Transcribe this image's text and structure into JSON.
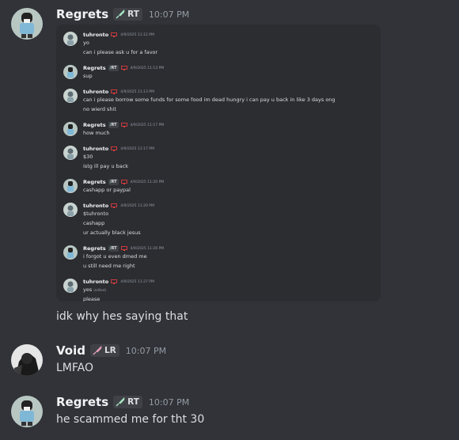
{
  "messages": [
    {
      "username": "Regrets",
      "tag": "RT",
      "time": "10:07 PM",
      "embedded_screenshot": {
        "messages": [
          {
            "username": "tuhronto",
            "time": "4/9/2025 11:12 PM",
            "lines": [
              "yo",
              "can i please ask u for a favor"
            ]
          },
          {
            "username": "Regrets",
            "tag": "RT",
            "time": "4/9/2025 11:13 PM",
            "lines": [
              "sup"
            ]
          },
          {
            "username": "tuhronto",
            "time": "4/9/2025 11:13 PM",
            "lines": [
              "can i please borrow some funds for some food im dead hungry i can pay u back in like 3 days ong",
              "no wierd shit"
            ]
          },
          {
            "username": "Regrets",
            "tag": "RT",
            "time": "4/9/2025 11:17 PM",
            "lines": [
              "how much"
            ]
          },
          {
            "username": "tuhronto",
            "time": "4/9/2025 11:17 PM",
            "lines": [
              "$30",
              "istg ill pay u back"
            ]
          },
          {
            "username": "Regrets",
            "tag": "RT",
            "time": "4/9/2025 11:20 PM",
            "lines": [
              "cashapp or paypal"
            ]
          },
          {
            "username": "tuhronto",
            "time": "4/9/2025 11:20 PM",
            "lines": [
              "$tuhronto",
              "cashapp",
              "ur actually black jesus"
            ]
          },
          {
            "username": "Regrets",
            "tag": "RT",
            "time": "4/9/2025 11:26 PM",
            "lines": [
              "i forgot u even dmed me",
              "u still need me right"
            ]
          },
          {
            "username": "tuhronto",
            "time": "4/9/2025 11:27 PM",
            "lines": [
              "yes",
              "please"
            ],
            "edited_label": "(edited)"
          }
        ]
      },
      "content": "idk why hes saying that"
    },
    {
      "username": "Void",
      "tag": "LR",
      "time": "10:07 PM",
      "content": "LMFAO"
    },
    {
      "username": "Regrets",
      "tag": "RT",
      "time": "10:07 PM",
      "content": "he scammed me for tht 30"
    }
  ],
  "colors": {
    "background": "#313338",
    "embed_background": "#2b2d31",
    "tag_background": "#3f4147",
    "timestamp": "#949ba4",
    "username": "#f2f3f5",
    "text": "#dbdee1",
    "sword_icon": "#a8e6c3",
    "sword_icon_lr": "#e8a0b8",
    "device_icon": "#f23f43"
  }
}
